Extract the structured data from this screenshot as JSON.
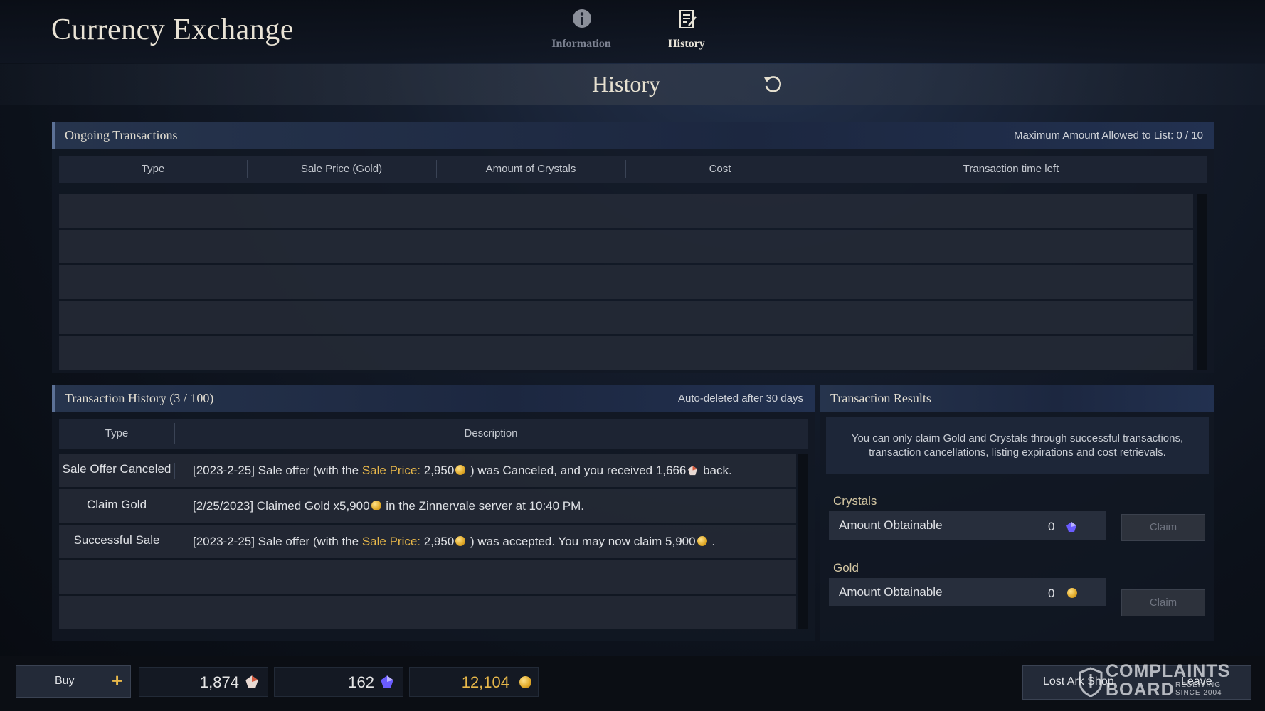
{
  "header": {
    "app_title": "Currency Exchange",
    "tabs": [
      {
        "label": "Information",
        "icon": "info-icon",
        "active": false
      },
      {
        "label": "History",
        "icon": "history-icon",
        "active": true
      }
    ]
  },
  "page": {
    "title": "History",
    "refresh_icon": "refresh-icon"
  },
  "ongoing": {
    "title": "Ongoing Transactions",
    "limit_text": "Maximum Amount Allowed to List: 0 / 10",
    "columns": [
      "Type",
      "Sale Price (Gold)",
      "Amount of Crystals",
      "Cost",
      "Transaction time left"
    ],
    "rows": []
  },
  "history": {
    "title": "Transaction History (3 / 100)",
    "note": "Auto-deleted after 30 days",
    "columns": [
      "Type",
      "Description"
    ],
    "rows": [
      {
        "type": "Sale Offer Canceled",
        "d1": "[2023-2-25] Sale offer (with the ",
        "d2": "Sale Price:",
        "d3": " 2,950",
        "d4": " ) was Canceled, and you received 1,666",
        "d5": " back."
      },
      {
        "type": "Claim Gold",
        "d1": "[2/25/2023] Claimed Gold x5,900",
        "d2": " in the Zinnervale server at 10:40 PM."
      },
      {
        "type": "Successful Sale",
        "d1": "[2023-2-25] Sale offer (with the ",
        "d2": "Sale Price:",
        "d3": " 2,950",
        "d4": " ) was accepted. You may now claim 5,900",
        "d5": " ."
      }
    ]
  },
  "results": {
    "title": "Transaction Results",
    "note": "You can only claim Gold and Crystals through successful transactions, transaction cancellations, listing expirations and cost retrievals.",
    "crystals": {
      "section": "Crystals",
      "label": "Amount Obtainable",
      "value": "0",
      "claim": "Claim"
    },
    "gold": {
      "section": "Gold",
      "label": "Amount Obtainable",
      "value": "0",
      "claim": "Claim"
    }
  },
  "footer": {
    "buy_label": "Buy",
    "plus": "+",
    "royal_crystals": "1,874",
    "blue_crystals": "162",
    "gold": "12,104",
    "shop_label": "Lost Ark Shop",
    "leave_label": "Leave"
  },
  "watermark": {
    "line1": "COMPLAINTS",
    "line2": "BOARD",
    "tag1": "RECEIVING",
    "tag2": "SINCE 2004"
  },
  "colors": {
    "highlight": "#e8b84a",
    "gold_coin": "#e0a826",
    "blue_crystal": "#6a5cff"
  }
}
